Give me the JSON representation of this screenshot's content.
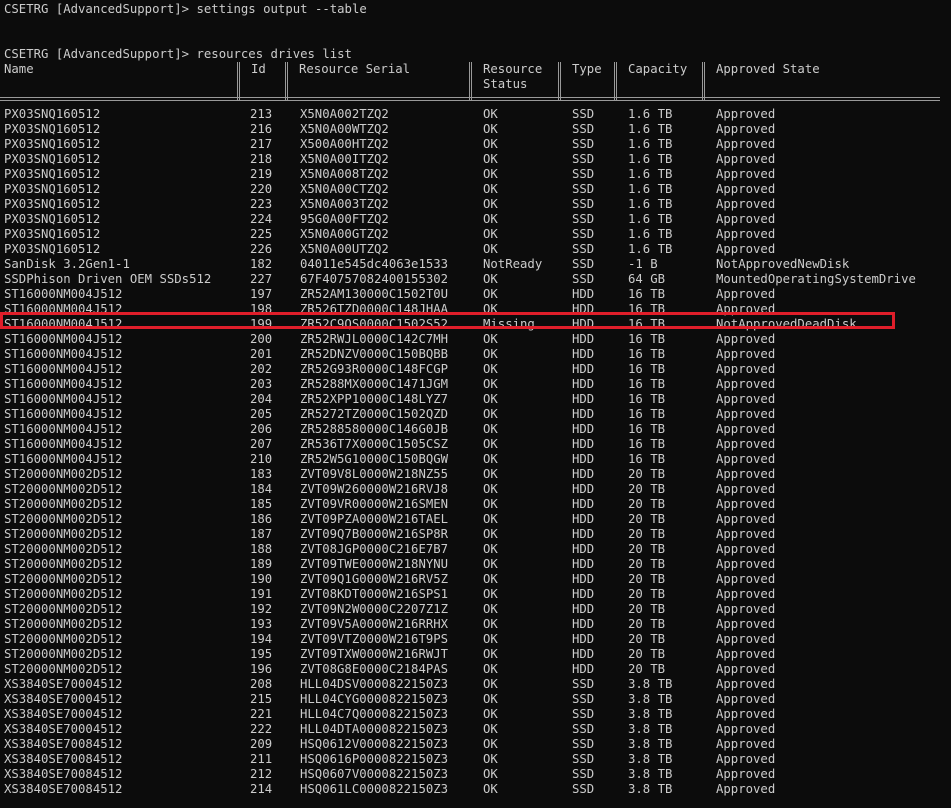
{
  "terminal": {
    "line1": "CSETRG [AdvancedSupport]> settings output --table",
    "line2": "CSETRG [AdvancedSupport]> resources drives list"
  },
  "table": {
    "headers": {
      "name": "Name",
      "id": "Id",
      "serial": "Resource Serial",
      "status": "Resource\nStatus",
      "type": "Type",
      "capacity": "Capacity",
      "state": "Approved State"
    },
    "highlight_color": "#e01e2a",
    "highlighted_row_index": 14,
    "rows": [
      {
        "name": "PX03SNQ160512",
        "id": "213",
        "serial": "X5N0A002TZQ2",
        "status": "OK",
        "type": "SSD",
        "capacity": "1.6 TB",
        "state": "Approved"
      },
      {
        "name": "PX03SNQ160512",
        "id": "216",
        "serial": "X5N0A00WTZQ2",
        "status": "OK",
        "type": "SSD",
        "capacity": "1.6 TB",
        "state": "Approved"
      },
      {
        "name": "PX03SNQ160512",
        "id": "217",
        "serial": "X500A00HTZQ2",
        "status": "OK",
        "type": "SSD",
        "capacity": "1.6 TB",
        "state": "Approved"
      },
      {
        "name": "PX03SNQ160512",
        "id": "218",
        "serial": "X5N0A00ITZQ2",
        "status": "OK",
        "type": "SSD",
        "capacity": "1.6 TB",
        "state": "Approved"
      },
      {
        "name": "PX03SNQ160512",
        "id": "219",
        "serial": "X5N0A008TZQ2",
        "status": "OK",
        "type": "SSD",
        "capacity": "1.6 TB",
        "state": "Approved"
      },
      {
        "name": "PX03SNQ160512",
        "id": "220",
        "serial": "X5N0A00CTZQ2",
        "status": "OK",
        "type": "SSD",
        "capacity": "1.6 TB",
        "state": "Approved"
      },
      {
        "name": "PX03SNQ160512",
        "id": "223",
        "serial": "X5N0A003TZQ2",
        "status": "OK",
        "type": "SSD",
        "capacity": "1.6 TB",
        "state": "Approved"
      },
      {
        "name": "PX03SNQ160512",
        "id": "224",
        "serial": "95G0A00FTZQ2",
        "status": "OK",
        "type": "SSD",
        "capacity": "1.6 TB",
        "state": "Approved"
      },
      {
        "name": "PX03SNQ160512",
        "id": "225",
        "serial": "X5N0A00GTZQ2",
        "status": "OK",
        "type": "SSD",
        "capacity": "1.6 TB",
        "state": "Approved"
      },
      {
        "name": "PX03SNQ160512",
        "id": "226",
        "serial": "X5N0A00UTZQ2",
        "status": "OK",
        "type": "SSD",
        "capacity": "1.6 TB",
        "state": "Approved"
      },
      {
        "name": "SanDisk 3.2Gen1-1",
        "id": "182",
        "serial": "04011e545dc4063e1533",
        "status": "NotReady",
        "type": "SSD",
        "capacity": "-1 B",
        "state": "NotApprovedNewDisk"
      },
      {
        "name": "SSDPhison Driven OEM SSDs512",
        "id": "227",
        "serial": "67F40757082400155302",
        "status": "OK",
        "type": "SSD",
        "capacity": "64 GB",
        "state": "MountedOperatingSystemDrive"
      },
      {
        "name": "ST16000NM004J512",
        "id": "197",
        "serial": "ZR52AM130000C1502T0U",
        "status": "OK",
        "type": "HDD",
        "capacity": "16 TB",
        "state": "Approved"
      },
      {
        "name": "ST16000NM004J512",
        "id": "198",
        "serial": "ZR526TZD0000C148JHAA",
        "status": "OK",
        "type": "HDD",
        "capacity": "16 TB",
        "state": "Approved"
      },
      {
        "name": "ST16000NM004J512",
        "id": "199",
        "serial": "ZR52C9QS0000C1502S52",
        "status": "Missing",
        "type": "HDD",
        "capacity": "16 TB",
        "state": "NotApprovedDeadDisk"
      },
      {
        "name": "ST16000NM004J512",
        "id": "200",
        "serial": "ZR52RWJL0000C142C7MH",
        "status": "OK",
        "type": "HDD",
        "capacity": "16 TB",
        "state": "Approved"
      },
      {
        "name": "ST16000NM004J512",
        "id": "201",
        "serial": "ZR52DNZV0000C150BQBB",
        "status": "OK",
        "type": "HDD",
        "capacity": "16 TB",
        "state": "Approved"
      },
      {
        "name": "ST16000NM004J512",
        "id": "202",
        "serial": "ZR52G93R0000C148FCGP",
        "status": "OK",
        "type": "HDD",
        "capacity": "16 TB",
        "state": "Approved"
      },
      {
        "name": "ST16000NM004J512",
        "id": "203",
        "serial": "ZR5288MX0000C1471JGM",
        "status": "OK",
        "type": "HDD",
        "capacity": "16 TB",
        "state": "Approved"
      },
      {
        "name": "ST16000NM004J512",
        "id": "204",
        "serial": "ZR52XPP10000C148LYZ7",
        "status": "OK",
        "type": "HDD",
        "capacity": "16 TB",
        "state": "Approved"
      },
      {
        "name": "ST16000NM004J512",
        "id": "205",
        "serial": "ZR5272TZ0000C1502QZD",
        "status": "OK",
        "type": "HDD",
        "capacity": "16 TB",
        "state": "Approved"
      },
      {
        "name": "ST16000NM004J512",
        "id": "206",
        "serial": "ZR5288580000C146G0JB",
        "status": "OK",
        "type": "HDD",
        "capacity": "16 TB",
        "state": "Approved"
      },
      {
        "name": "ST16000NM004J512",
        "id": "207",
        "serial": "ZR536T7X0000C1505CSZ",
        "status": "OK",
        "type": "HDD",
        "capacity": "16 TB",
        "state": "Approved"
      },
      {
        "name": "ST16000NM004J512",
        "id": "210",
        "serial": "ZR52W5G10000C150BQGW",
        "status": "OK",
        "type": "HDD",
        "capacity": "16 TB",
        "state": "Approved"
      },
      {
        "name": "ST20000NM002D512",
        "id": "183",
        "serial": "ZVT09V8L0000W218NZ55",
        "status": "OK",
        "type": "HDD",
        "capacity": "20 TB",
        "state": "Approved"
      },
      {
        "name": "ST20000NM002D512",
        "id": "184",
        "serial": "ZVT09W260000W216RVJ8",
        "status": "OK",
        "type": "HDD",
        "capacity": "20 TB",
        "state": "Approved"
      },
      {
        "name": "ST20000NM002D512",
        "id": "185",
        "serial": "ZVT09VR00000W216SMEN",
        "status": "OK",
        "type": "HDD",
        "capacity": "20 TB",
        "state": "Approved"
      },
      {
        "name": "ST20000NM002D512",
        "id": "186",
        "serial": "ZVT09PZA0000W216TAEL",
        "status": "OK",
        "type": "HDD",
        "capacity": "20 TB",
        "state": "Approved"
      },
      {
        "name": "ST20000NM002D512",
        "id": "187",
        "serial": "ZVT09Q7B0000W216SP8R",
        "status": "OK",
        "type": "HDD",
        "capacity": "20 TB",
        "state": "Approved"
      },
      {
        "name": "ST20000NM002D512",
        "id": "188",
        "serial": "ZVT08JGP0000C216E7B7",
        "status": "OK",
        "type": "HDD",
        "capacity": "20 TB",
        "state": "Approved"
      },
      {
        "name": "ST20000NM002D512",
        "id": "189",
        "serial": "ZVT09TWE0000W218NYNU",
        "status": "OK",
        "type": "HDD",
        "capacity": "20 TB",
        "state": "Approved"
      },
      {
        "name": "ST20000NM002D512",
        "id": "190",
        "serial": "ZVT09Q1G0000W216RV5Z",
        "status": "OK",
        "type": "HDD",
        "capacity": "20 TB",
        "state": "Approved"
      },
      {
        "name": "ST20000NM002D512",
        "id": "191",
        "serial": "ZVT08KDT0000W216SPS1",
        "status": "OK",
        "type": "HDD",
        "capacity": "20 TB",
        "state": "Approved"
      },
      {
        "name": "ST20000NM002D512",
        "id": "192",
        "serial": "ZVT09N2W0000C2207Z1Z",
        "status": "OK",
        "type": "HDD",
        "capacity": "20 TB",
        "state": "Approved"
      },
      {
        "name": "ST20000NM002D512",
        "id": "193",
        "serial": "ZVT09V5A0000W216RRHX",
        "status": "OK",
        "type": "HDD",
        "capacity": "20 TB",
        "state": "Approved"
      },
      {
        "name": "ST20000NM002D512",
        "id": "194",
        "serial": "ZVT09VTZ0000W216T9PS",
        "status": "OK",
        "type": "HDD",
        "capacity": "20 TB",
        "state": "Approved"
      },
      {
        "name": "ST20000NM002D512",
        "id": "195",
        "serial": "ZVT09TXW0000W216RWJT",
        "status": "OK",
        "type": "HDD",
        "capacity": "20 TB",
        "state": "Approved"
      },
      {
        "name": "ST20000NM002D512",
        "id": "196",
        "serial": "ZVT08G8E0000C2184PAS",
        "status": "OK",
        "type": "HDD",
        "capacity": "20 TB",
        "state": "Approved"
      },
      {
        "name": "XS3840SE70004512",
        "id": "208",
        "serial": "HLL04DSV0000822150Z3",
        "status": "OK",
        "type": "SSD",
        "capacity": "3.8 TB",
        "state": "Approved"
      },
      {
        "name": "XS3840SE70004512",
        "id": "215",
        "serial": "HLL04CYG0000822150Z3",
        "status": "OK",
        "type": "SSD",
        "capacity": "3.8 TB",
        "state": "Approved"
      },
      {
        "name": "XS3840SE70004512",
        "id": "221",
        "serial": "HLL04C7Q0000822150Z3",
        "status": "OK",
        "type": "SSD",
        "capacity": "3.8 TB",
        "state": "Approved"
      },
      {
        "name": "XS3840SE70004512",
        "id": "222",
        "serial": "HLL04DTA0000822150Z3",
        "status": "OK",
        "type": "SSD",
        "capacity": "3.8 TB",
        "state": "Approved"
      },
      {
        "name": "XS3840SE70084512",
        "id": "209",
        "serial": "HSQ0612V0000822150Z3",
        "status": "OK",
        "type": "SSD",
        "capacity": "3.8 TB",
        "state": "Approved"
      },
      {
        "name": "XS3840SE70084512",
        "id": "211",
        "serial": "HSQ0616P0000822150Z3",
        "status": "OK",
        "type": "SSD",
        "capacity": "3.8 TB",
        "state": "Approved"
      },
      {
        "name": "XS3840SE70084512",
        "id": "212",
        "serial": "HSQ0607V0000822150Z3",
        "status": "OK",
        "type": "SSD",
        "capacity": "3.8 TB",
        "state": "Approved"
      },
      {
        "name": "XS3840SE70084512",
        "id": "214",
        "serial": "HSQ061LC0000822150Z3",
        "status": "OK",
        "type": "SSD",
        "capacity": "3.8 TB",
        "state": "Approved"
      }
    ]
  }
}
